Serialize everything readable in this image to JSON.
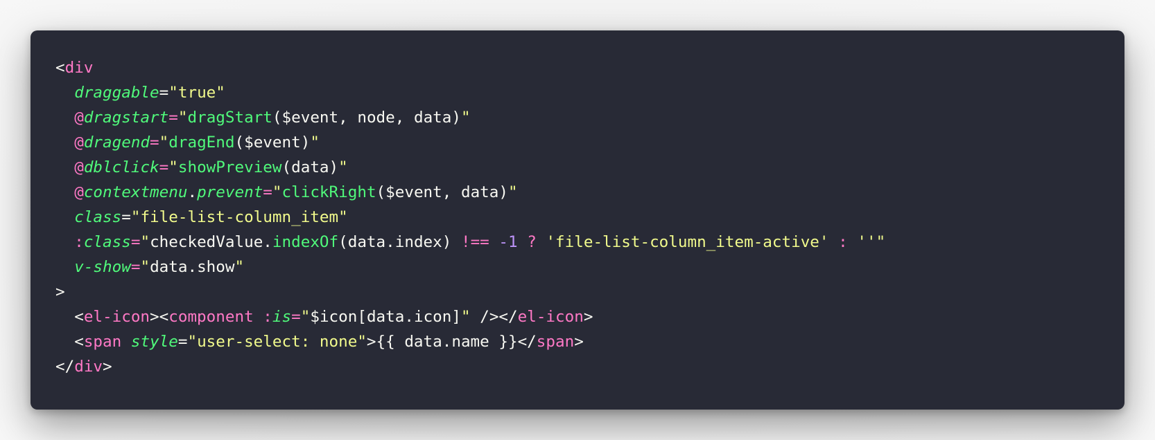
{
  "colors": {
    "background": "#282a36",
    "foreground": "#f8f8f2",
    "tag": "#ff79c6",
    "attribute": "#50fa7b",
    "string": "#f1fa8c",
    "number": "#bd93f9",
    "page_background": "#f1f1f1"
  },
  "code_lines": [
    [
      {
        "text": "<",
        "kind": "punct"
      },
      {
        "text": "div",
        "kind": "tag"
      }
    ],
    [
      {
        "text": "  ",
        "kind": "plain"
      },
      {
        "text": "draggable",
        "kind": "attr"
      },
      {
        "text": "=",
        "kind": "punct"
      },
      {
        "text": "\"true\"",
        "kind": "str"
      }
    ],
    [
      {
        "text": "  ",
        "kind": "plain"
      },
      {
        "text": "@",
        "kind": "at"
      },
      {
        "text": "dragstart",
        "kind": "attr"
      },
      {
        "text": "=",
        "kind": "op"
      },
      {
        "text": "\"",
        "kind": "str"
      },
      {
        "text": "dragStart",
        "kind": "fn"
      },
      {
        "text": "($event, node, data)",
        "kind": "plain"
      },
      {
        "text": "\"",
        "kind": "str"
      }
    ],
    [
      {
        "text": "  ",
        "kind": "plain"
      },
      {
        "text": "@",
        "kind": "at"
      },
      {
        "text": "dragend",
        "kind": "attr"
      },
      {
        "text": "=",
        "kind": "op"
      },
      {
        "text": "\"",
        "kind": "str"
      },
      {
        "text": "dragEnd",
        "kind": "fn"
      },
      {
        "text": "($event)",
        "kind": "plain"
      },
      {
        "text": "\"",
        "kind": "str"
      }
    ],
    [
      {
        "text": "  ",
        "kind": "plain"
      },
      {
        "text": "@",
        "kind": "at"
      },
      {
        "text": "dblclick",
        "kind": "attr"
      },
      {
        "text": "=",
        "kind": "op"
      },
      {
        "text": "\"",
        "kind": "str"
      },
      {
        "text": "showPreview",
        "kind": "fn"
      },
      {
        "text": "(data)",
        "kind": "plain"
      },
      {
        "text": "\"",
        "kind": "str"
      }
    ],
    [
      {
        "text": "  ",
        "kind": "plain"
      },
      {
        "text": "@",
        "kind": "at"
      },
      {
        "text": "contextmenu",
        "kind": "attr"
      },
      {
        "text": ".",
        "kind": "punct"
      },
      {
        "text": "prevent",
        "kind": "mod"
      },
      {
        "text": "=",
        "kind": "op"
      },
      {
        "text": "\"",
        "kind": "str"
      },
      {
        "text": "clickRight",
        "kind": "fn"
      },
      {
        "text": "($event, data)",
        "kind": "plain"
      },
      {
        "text": "\"",
        "kind": "str"
      }
    ],
    [
      {
        "text": "  ",
        "kind": "plain"
      },
      {
        "text": "class",
        "kind": "attr"
      },
      {
        "text": "=",
        "kind": "punct"
      },
      {
        "text": "\"file-list-column_item\"",
        "kind": "str"
      }
    ],
    [
      {
        "text": "  ",
        "kind": "plain"
      },
      {
        "text": ":",
        "kind": "at"
      },
      {
        "text": "class",
        "kind": "attr"
      },
      {
        "text": "=",
        "kind": "op"
      },
      {
        "text": "\"",
        "kind": "str"
      },
      {
        "text": "checkedValue.",
        "kind": "plain"
      },
      {
        "text": "indexOf",
        "kind": "fn"
      },
      {
        "text": "(data.index) ",
        "kind": "plain"
      },
      {
        "text": "!==",
        "kind": "op"
      },
      {
        "text": " ",
        "kind": "plain"
      },
      {
        "text": "-1",
        "kind": "num"
      },
      {
        "text": " ",
        "kind": "plain"
      },
      {
        "text": "?",
        "kind": "op"
      },
      {
        "text": " ",
        "kind": "plain"
      },
      {
        "text": "'file-list-column_item-active'",
        "kind": "str"
      },
      {
        "text": " ",
        "kind": "plain"
      },
      {
        "text": ":",
        "kind": "op"
      },
      {
        "text": " ",
        "kind": "plain"
      },
      {
        "text": "''",
        "kind": "str"
      },
      {
        "text": "\"",
        "kind": "str"
      }
    ],
    [
      {
        "text": "  ",
        "kind": "plain"
      },
      {
        "text": "v-show",
        "kind": "attr"
      },
      {
        "text": "=",
        "kind": "op"
      },
      {
        "text": "\"",
        "kind": "str"
      },
      {
        "text": "data.show",
        "kind": "plain"
      },
      {
        "text": "\"",
        "kind": "str"
      }
    ],
    [
      {
        "text": ">",
        "kind": "punct"
      }
    ],
    [
      {
        "text": "  <",
        "kind": "punct"
      },
      {
        "text": "el-icon",
        "kind": "tag"
      },
      {
        "text": "><",
        "kind": "punct"
      },
      {
        "text": "component",
        "kind": "tag"
      },
      {
        "text": " ",
        "kind": "plain"
      },
      {
        "text": ":",
        "kind": "at"
      },
      {
        "text": "is",
        "kind": "attr"
      },
      {
        "text": "=",
        "kind": "op"
      },
      {
        "text": "\"",
        "kind": "str"
      },
      {
        "text": "$icon[data.icon]",
        "kind": "plain"
      },
      {
        "text": "\"",
        "kind": "str"
      },
      {
        "text": " /></",
        "kind": "punct"
      },
      {
        "text": "el-icon",
        "kind": "tag"
      },
      {
        "text": ">",
        "kind": "punct"
      }
    ],
    [
      {
        "text": "  <",
        "kind": "punct"
      },
      {
        "text": "span",
        "kind": "tag"
      },
      {
        "text": " ",
        "kind": "plain"
      },
      {
        "text": "style",
        "kind": "attr"
      },
      {
        "text": "=",
        "kind": "punct"
      },
      {
        "text": "\"user-select: none\"",
        "kind": "str"
      },
      {
        "text": ">{{ data.name }}</",
        "kind": "punct"
      },
      {
        "text": "span",
        "kind": "tag"
      },
      {
        "text": ">",
        "kind": "punct"
      }
    ],
    [
      {
        "text": "</",
        "kind": "punct"
      },
      {
        "text": "div",
        "kind": "tag"
      },
      {
        "text": ">",
        "kind": "punct"
      }
    ]
  ]
}
